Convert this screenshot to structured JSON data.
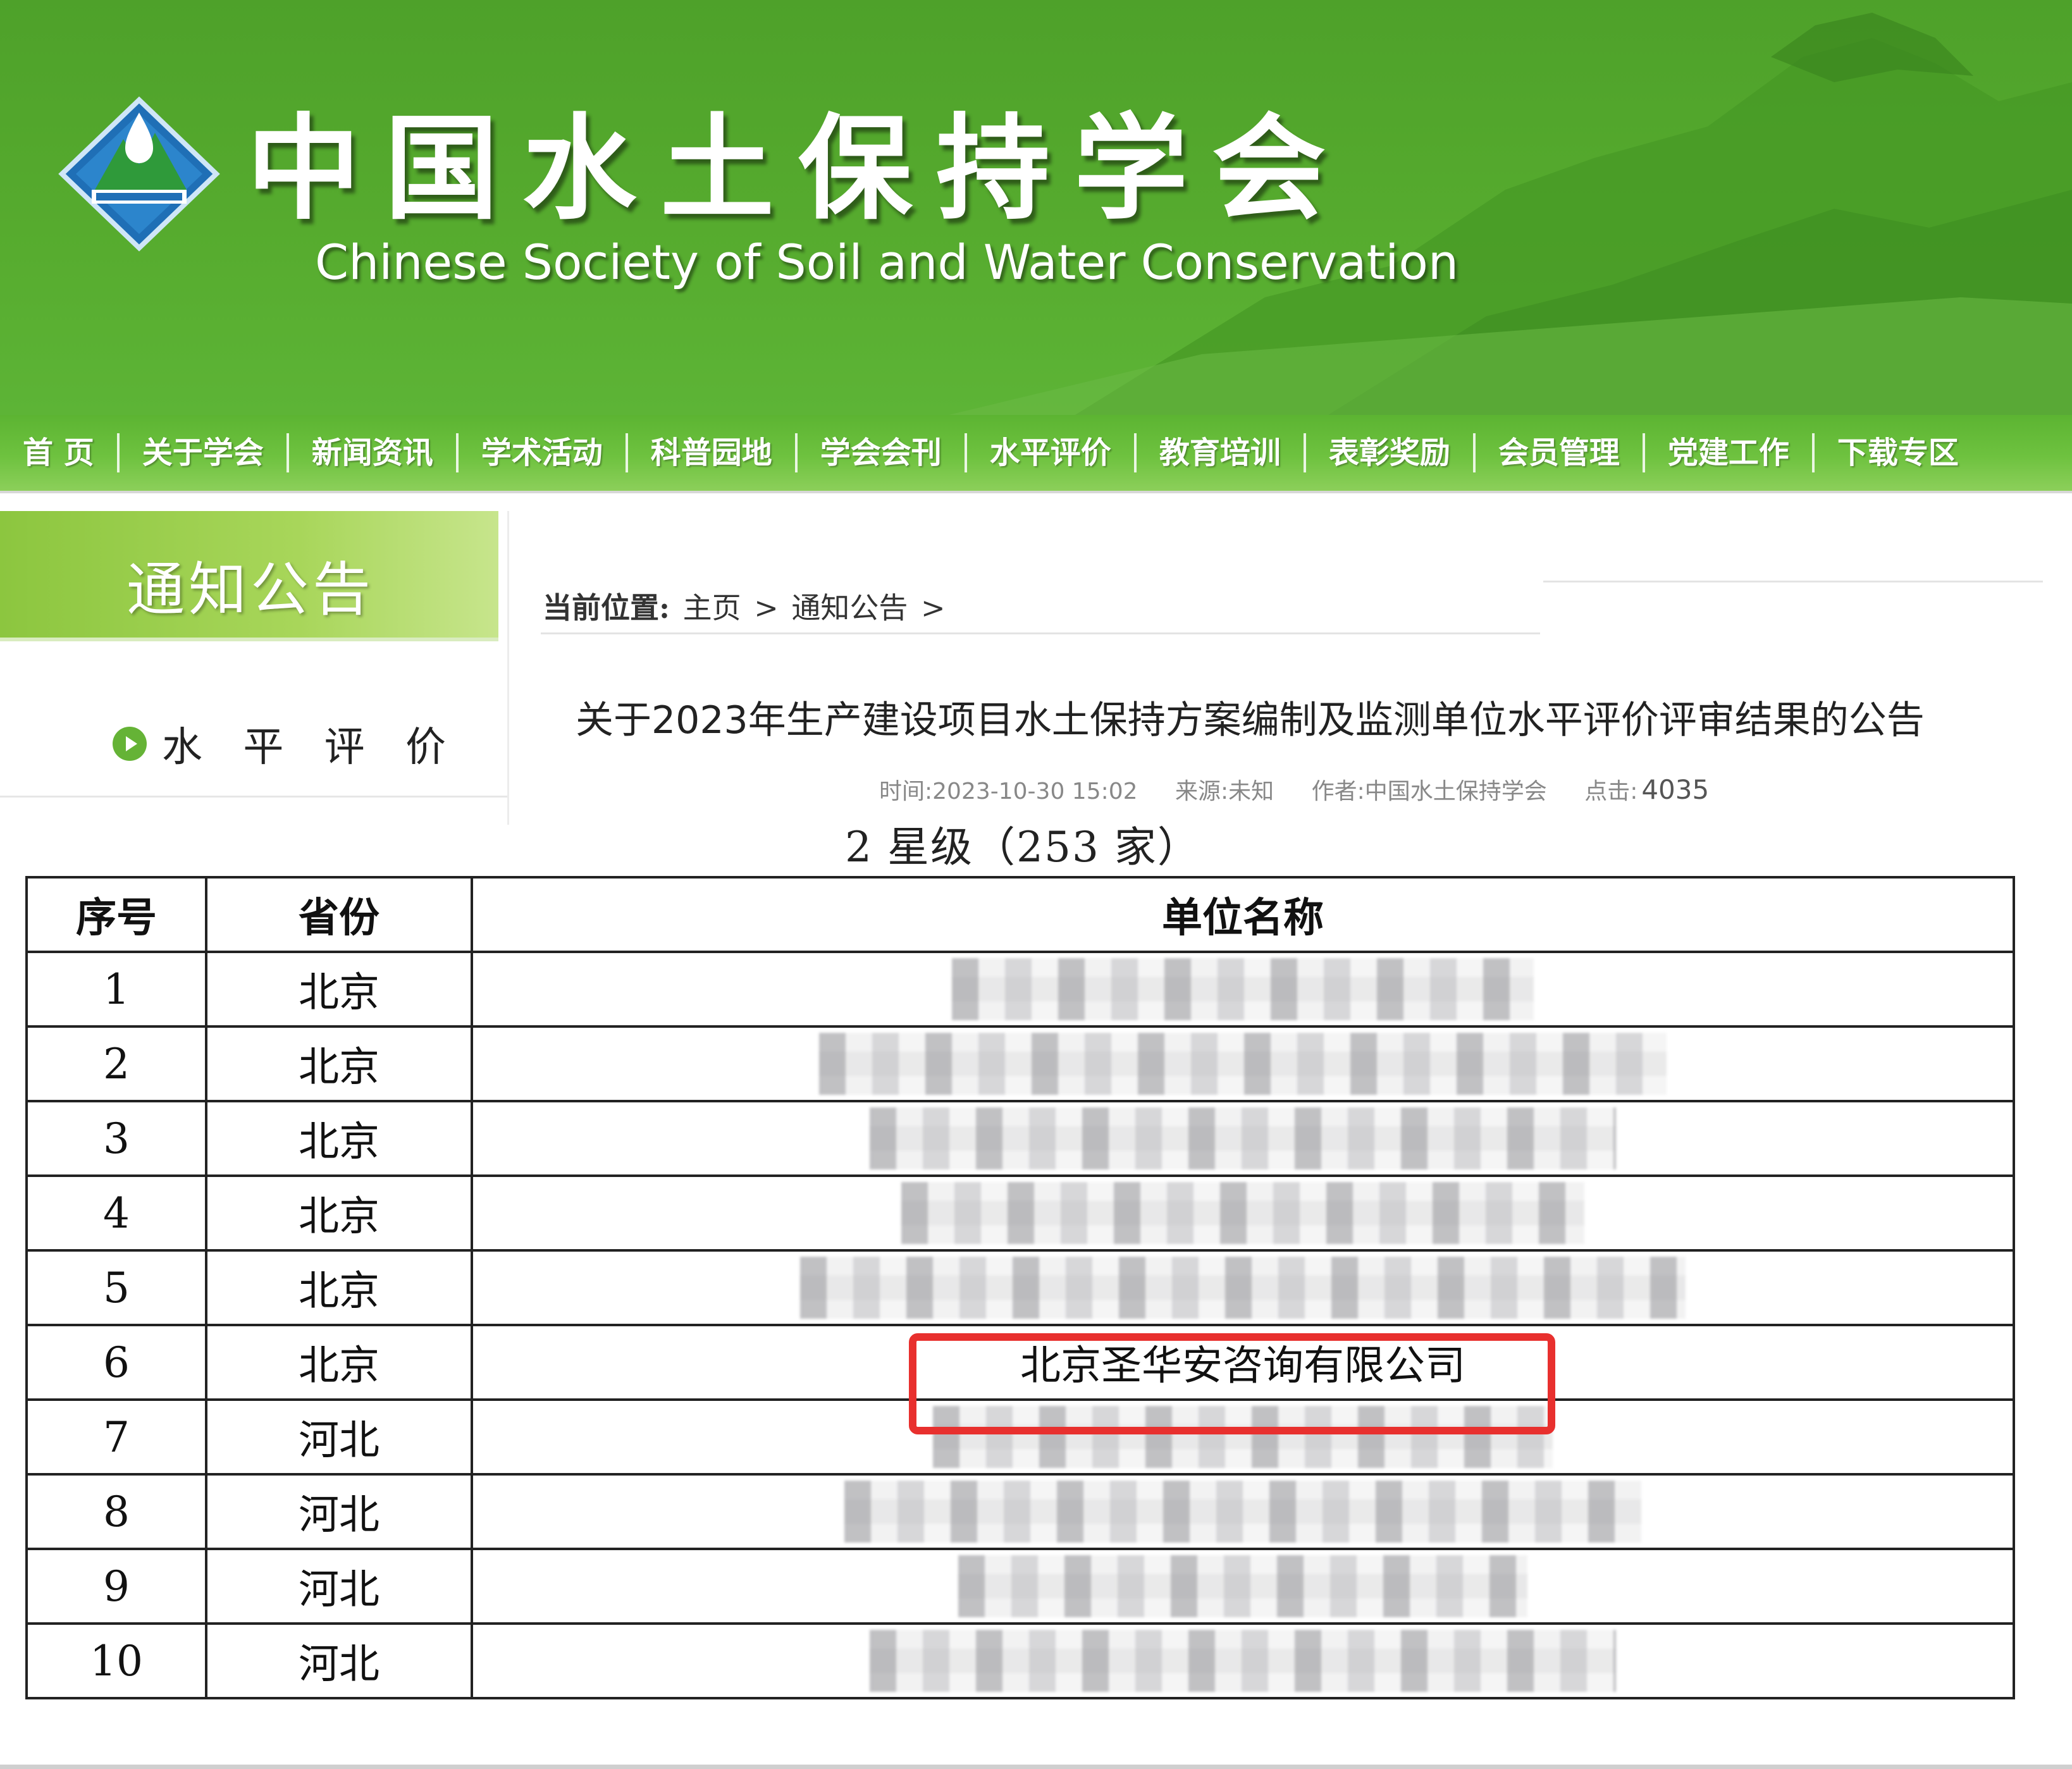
{
  "header": {
    "title": "中国水土保持学会",
    "subtitle": "Chinese Society of Soil and Water Conservation",
    "logo_icon": "mountain-water-drop-logo"
  },
  "nav": {
    "items": [
      "首 页",
      "关于学会",
      "新闻资讯",
      "学术活动",
      "科普园地",
      "学会会刊",
      "水平评价",
      "教育培训",
      "表彰奖励",
      "会员管理",
      "党建工作",
      "下载专区"
    ]
  },
  "sidebar": {
    "heading": "通知公告",
    "items": [
      {
        "label": "水 平 评 价",
        "icon": "play-circle-icon"
      }
    ]
  },
  "breadcrumb": {
    "label": "当前位置:",
    "home": "主页",
    "sep1": ">",
    "section": "通知公告",
    "sep2": ">"
  },
  "article": {
    "title": "关于2023年生产建设项目水土保持方案编制及监测单位水平评价评审结果的公告",
    "time": "时间:2023-10-30 15:02",
    "source": "来源:未知",
    "author": "作者:中国水土保持学会",
    "clicks_label": "点击:",
    "clicks_value": "4035",
    "section_heading": "2 星级（253 家）"
  },
  "table": {
    "headers": [
      "序号",
      "省份",
      "单位名称"
    ],
    "rows": [
      {
        "no": "1",
        "province": "北京",
        "name": ""
      },
      {
        "no": "2",
        "province": "北京",
        "name": ""
      },
      {
        "no": "3",
        "province": "北京",
        "name": ""
      },
      {
        "no": "4",
        "province": "北京",
        "name": ""
      },
      {
        "no": "5",
        "province": "北京",
        "name": ""
      },
      {
        "no": "6",
        "province": "北京",
        "name": "北京圣华安咨询有限公司"
      },
      {
        "no": "7",
        "province": "河北",
        "name": ""
      },
      {
        "no": "8",
        "province": "河北",
        "name": ""
      },
      {
        "no": "9",
        "province": "河北",
        "name": ""
      },
      {
        "no": "10",
        "province": "河北",
        "name": ""
      }
    ]
  },
  "colors": {
    "banner_green": "#56ab2e",
    "nav_green": "#6ec23f",
    "highlight_red": "#e8302e"
  }
}
